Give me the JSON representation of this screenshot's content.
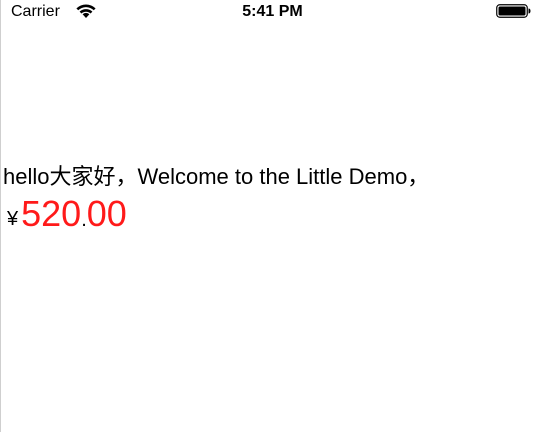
{
  "status_bar": {
    "carrier": "Carrier",
    "time": "5:41 PM",
    "icons": [
      "wifi-icon",
      "battery-icon"
    ]
  },
  "content": {
    "greeting": "hello大家好，Welcome to the Little Demo，",
    "price": {
      "currency": "¥",
      "integer": "520",
      "point": ".",
      "decimal": "00",
      "accent_color": "#ff1a1a"
    }
  }
}
